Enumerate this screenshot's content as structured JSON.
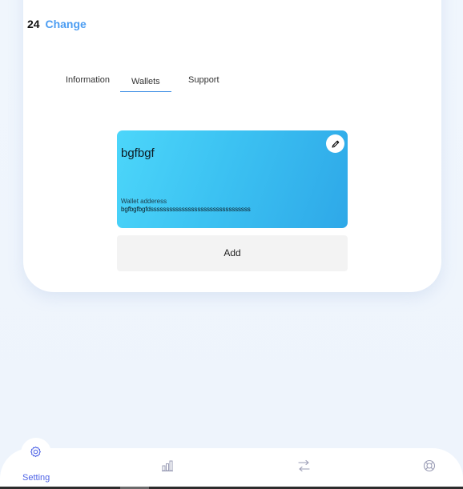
{
  "header": {
    "balance_value": "24",
    "change_link": "Change"
  },
  "tabs": [
    {
      "label": "Information",
      "active": false
    },
    {
      "label": "Wallets",
      "active": true
    },
    {
      "label": "Support",
      "active": false
    }
  ],
  "wallet": {
    "name": "bgfbgf",
    "address_label": "Wallet adderess",
    "address": "bgfbgfbgfdssssssssssssssssssssssssssssssss",
    "edit_icon": "pencil-icon",
    "gradient_start": "#4cd6fa",
    "gradient_end": "#2ea8e8"
  },
  "add_button": "Add",
  "bottom_nav": {
    "items": [
      {
        "icon": "gear-icon",
        "label": "Setting",
        "active": true
      },
      {
        "icon": "bar-chart-icon",
        "label": "",
        "active": false
      },
      {
        "icon": "transfer-arrows-icon",
        "label": "",
        "active": false
      },
      {
        "icon": "lifebuoy-icon",
        "label": "",
        "active": false
      }
    ],
    "active_color": "#4e63e6",
    "inactive_color": "#9a9cb5"
  },
  "colors": {
    "accent": "#4c9df2",
    "tab_underline": "#3b8ee5",
    "background": "#eef4fc"
  }
}
